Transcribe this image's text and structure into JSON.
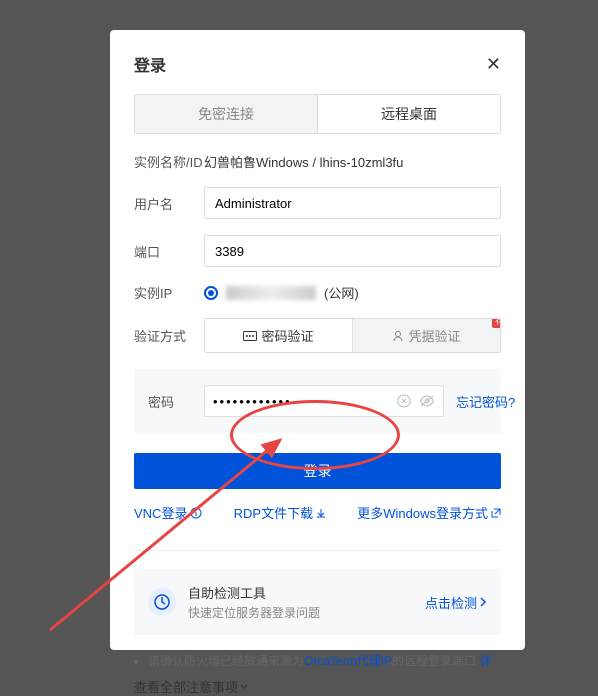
{
  "header": {
    "title": "登录"
  },
  "tabs": {
    "inactive": "免密连接",
    "active": "远程桌面"
  },
  "fields": {
    "instance_label": "实例名称/ID",
    "instance_value": "幻兽帕鲁Windows / lhins-10zml3fu",
    "user_label": "用户名",
    "user_value": "Administrator",
    "port_label": "端口",
    "port_value": "3389",
    "ip_label": "实例IP",
    "ip_suffix": "(公网)",
    "auth_label": "验证方式",
    "auth_password": "密码验证",
    "auth_credential": "凭据验证",
    "badge": "荐",
    "password_label": "密码",
    "password_value": "••••••••••••",
    "forgot": "忘记密码?"
  },
  "login_button": "登录",
  "links": {
    "vnc": "VNC登录",
    "rdp": "RDP文件下载",
    "more": "更多Windows登录方式"
  },
  "detect": {
    "title": "自助检测工具",
    "sub": "快速定位服务器登录问题",
    "action": "点击检测"
  },
  "notice": {
    "prefix": "请确认防火墙已经放通来源为",
    "link": "OrcaTerm代理IP",
    "suffix": "的远程登录端口",
    "more": "详",
    "view_all": "查看全部注意事项"
  }
}
